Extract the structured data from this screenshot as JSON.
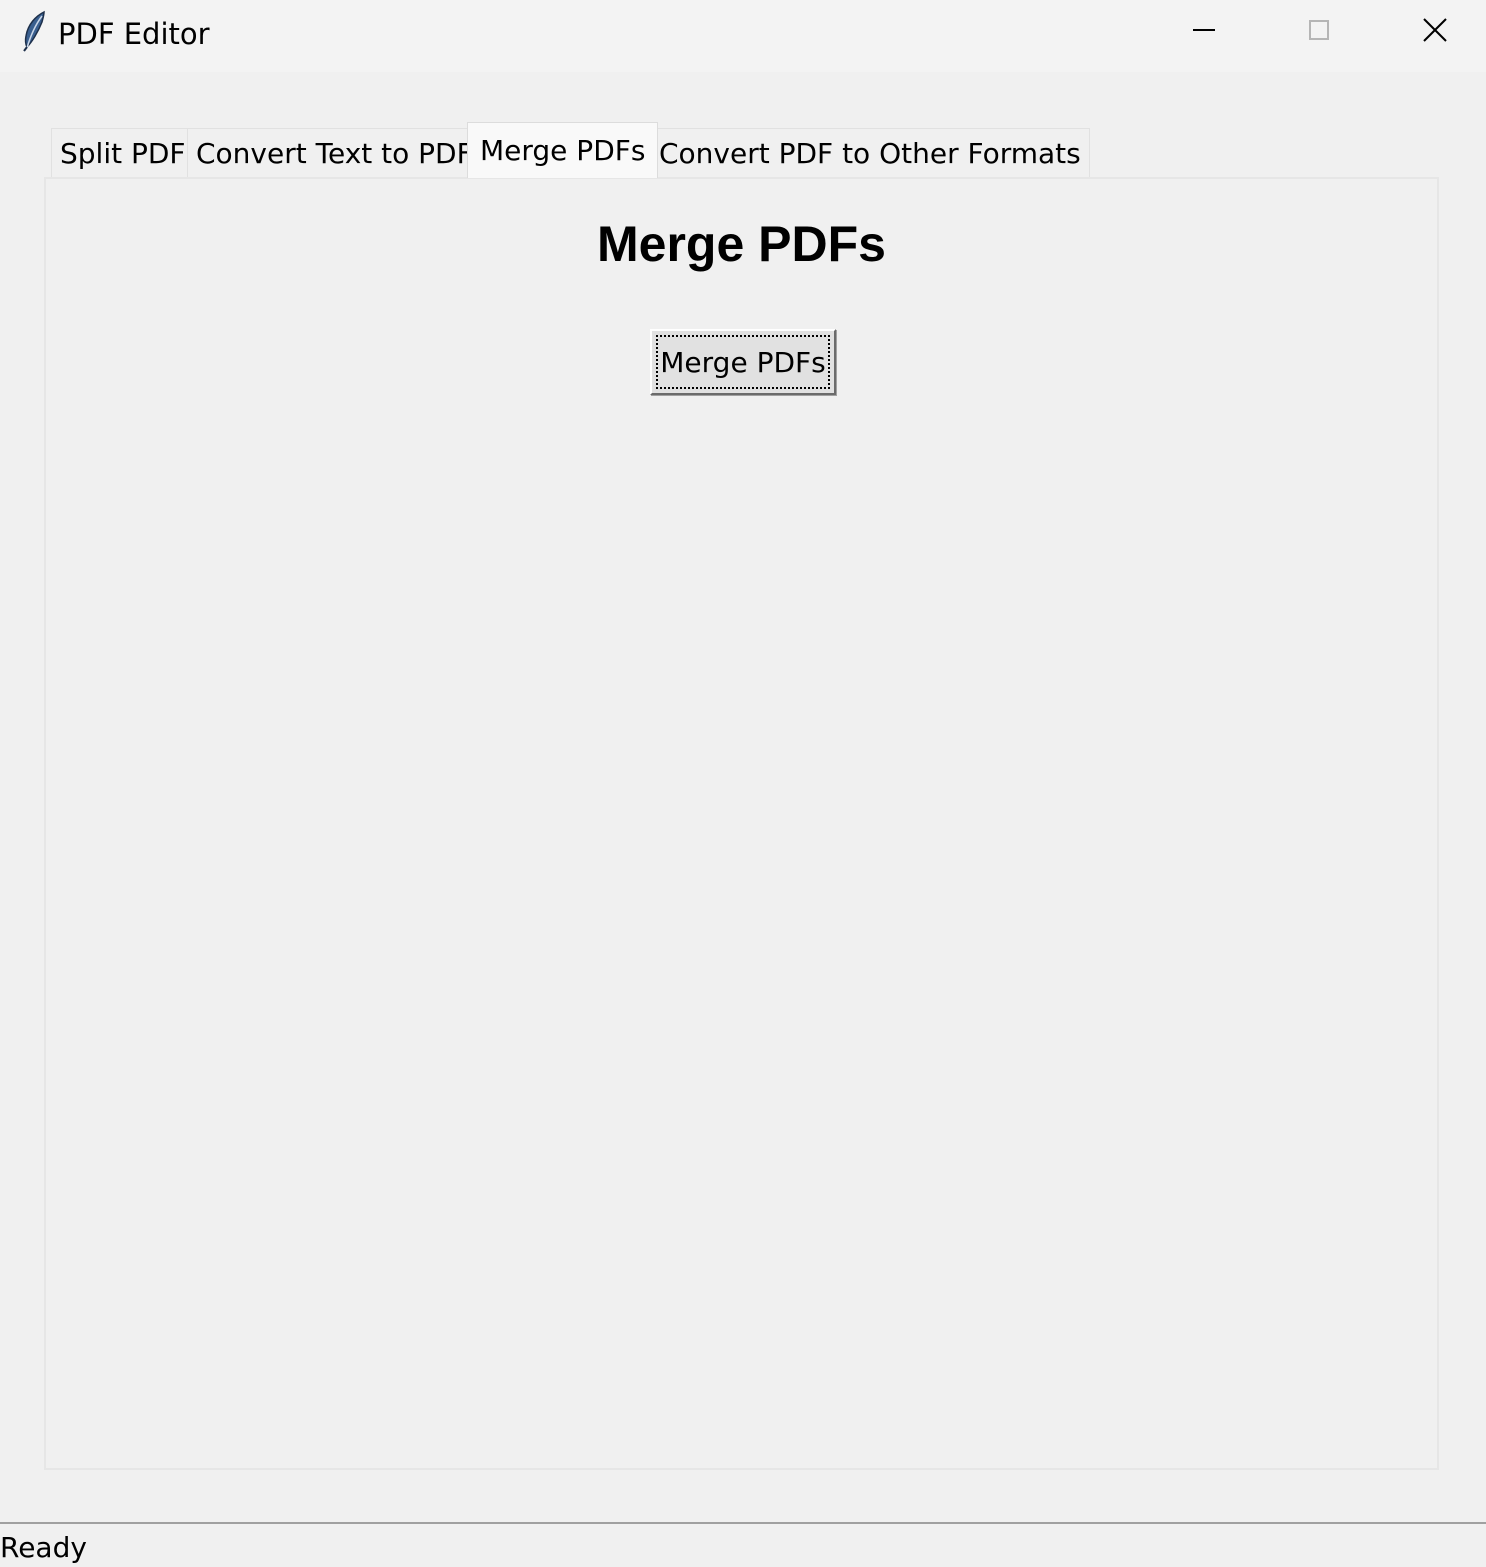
{
  "window": {
    "title": "PDF Editor",
    "app_icon": "feather-icon",
    "controls": {
      "minimize_icon": "minimize-icon",
      "maximize_icon": "maximize-icon",
      "close_icon": "close-icon"
    }
  },
  "notebook": {
    "tabs": [
      {
        "label": "Split PDF",
        "selected": false
      },
      {
        "label": "Convert Text to PDF",
        "selected": false
      },
      {
        "label": "Merge PDFs",
        "selected": true
      },
      {
        "label": "Convert PDF to Other Formats",
        "selected": false
      }
    ],
    "active_panel": {
      "heading": "Merge PDFs",
      "button_label": "Merge PDFs"
    }
  },
  "status_bar": {
    "text": "Ready"
  }
}
